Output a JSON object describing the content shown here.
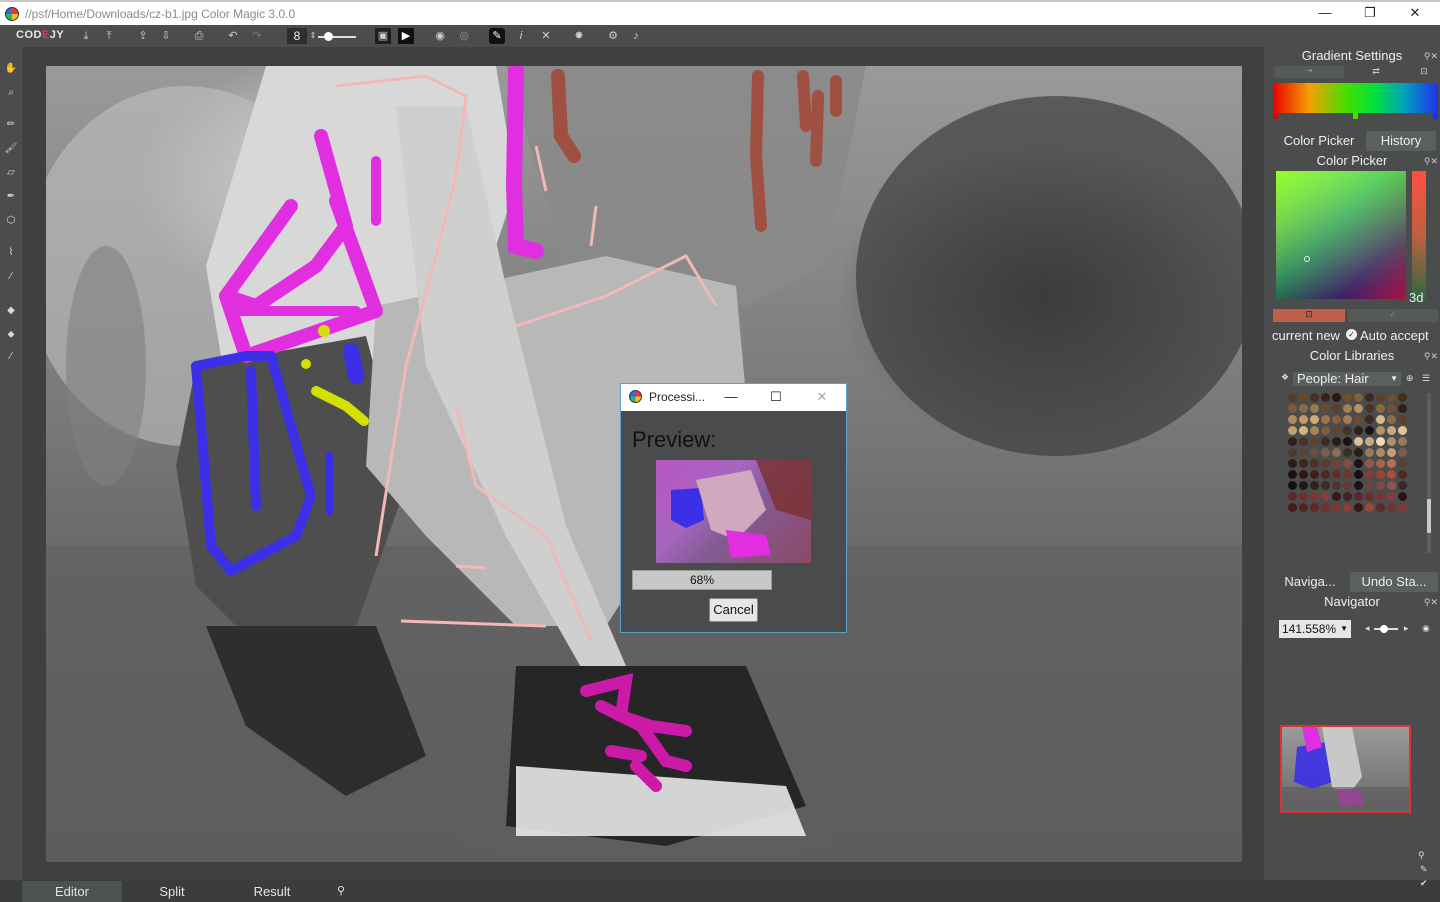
{
  "window": {
    "title": "//psf/Home/Downloads/cz-b1.jpg Color Magic 3.0.0",
    "minimize": "—",
    "maximize": "❐",
    "close": "✕"
  },
  "toolbar": {
    "logo_prefix": "COD",
    "logo_mid": "E",
    "logo_suffix": "JY",
    "brush_size": "8",
    "icons": [
      "import-icon",
      "export-icon",
      "upload-icon",
      "download-icon",
      "print-icon",
      "undo-icon",
      "redo-icon",
      "mask-icon",
      "play-icon",
      "eye-icon",
      "eye-off-icon",
      "colorize-icon",
      "info-icon",
      "expand-icon",
      "star-icon",
      "settings-icon",
      "music-icon"
    ]
  },
  "left_tools": [
    "hand-icon",
    "zoom-icon",
    "pencil-icon",
    "brush-icon",
    "eraser-icon",
    "pen-icon",
    "shape-icon",
    "dropper-icon",
    "line-icon",
    "fill-icon",
    "stamp-icon",
    "picker-icon"
  ],
  "dialog": {
    "title": "Processi...",
    "minimize": "—",
    "maximize": "☐",
    "close": "✕",
    "preview_label": "Preview:",
    "progress_value": 68,
    "progress_text": "68%",
    "cancel_label": "Cancel"
  },
  "bottom_tabs": [
    {
      "label": "Editor",
      "active": true
    },
    {
      "label": "Split",
      "active": false
    },
    {
      "label": "Result",
      "active": false
    }
  ],
  "right_panel": {
    "gradient": {
      "title": "Gradient Settings",
      "colors": [
        "#e80000",
        "#f5a000",
        "#40e000",
        "#00e040",
        "#00a0c0",
        "#2030e8"
      ]
    },
    "tabs_top": [
      {
        "label": "Color Picker",
        "active": true
      },
      {
        "label": "History",
        "active": false
      }
    ],
    "color_picker": {
      "title": "Color Picker",
      "hex_fragment": "3d",
      "current_label": "current",
      "new_label": "new",
      "auto_accept_label": "Auto accept",
      "current_color": "#c0604a"
    },
    "color_libraries": {
      "title": "Color Libraries",
      "selected_library": "People: Hair",
      "swatches": [
        "#5a3a22",
        "#6a4528",
        "#4a3020",
        "#3a2418",
        "#2a1a10",
        "#6e5030",
        "#80603a",
        "#3c2a1c",
        "#5c4030",
        "#704c30",
        "#462e1e",
        "#7a5a3a",
        "#8a6a48",
        "#9a7a52",
        "#6a4a2e",
        "#584030",
        "#a08058",
        "#b89068",
        "#4c3422",
        "#8e6640",
        "#70503a",
        "#2e2018",
        "#b08a5a",
        "#c49a68",
        "#d2aa78",
        "#9a744a",
        "#86603c",
        "#a47c4e",
        "#6c4c34",
        "#3a2a22",
        "#d8b888",
        "#8c6c48",
        "#5a4232",
        "#c0a070",
        "#d4b480",
        "#a88450",
        "#7e5c3c",
        "#604430",
        "#463226",
        "#2c201a",
        "#1c1410",
        "#b4946a",
        "#caa87c",
        "#e2c49a",
        "#302218",
        "#483424",
        "#5e4230",
        "#3e2c20",
        "#281c14",
        "#1a1210",
        "#d8c0a0",
        "#c8a888",
        "#f0dcbc",
        "#b0906c",
        "#98785a",
        "#4e3a2a",
        "#5a4434",
        "#6a5040",
        "#786050",
        "#8a6e58",
        "#3a2e26",
        "#242018",
        "#9c7a5c",
        "#ae8a68",
        "#bea080",
        "#7a604c",
        "#2a1c18",
        "#3c2620",
        "#4e3028",
        "#603a30",
        "#724438",
        "#844e3e",
        "#1e1412",
        "#965846",
        "#a8624e",
        "#ba6e56",
        "#564038",
        "#1a1010",
        "#2c1816",
        "#3e201c",
        "#502822",
        "#622e28",
        "#74342c",
        "#161010",
        "#863c32",
        "#984438",
        "#aa4c3e",
        "#4a2a24",
        "#101010",
        "#201818",
        "#302220",
        "#402a28",
        "#503230",
        "#603a36",
        "#181414",
        "#70423e",
        "#804a46",
        "#905450",
        "#382828",
        "#5e2a26",
        "#6e302a",
        "#7e3630",
        "#8e3c36",
        "#381a18",
        "#482220",
        "#582826",
        "#682e2c",
        "#783432",
        "#883a38",
        "#281412",
        "#401c1a",
        "#502422",
        "#602a28",
        "#70302e",
        "#803634",
        "#903c3a",
        "#301614",
        "#a0443e",
        "#5c2c2a",
        "#6c3432",
        "#7c3a38"
      ]
    },
    "tabs_bottom": [
      {
        "label": "Naviga...",
        "active": true
      },
      {
        "label": "Undo Sta...",
        "active": false
      }
    ],
    "navigator": {
      "title": "Navigator",
      "zoom": "141.558%"
    }
  }
}
